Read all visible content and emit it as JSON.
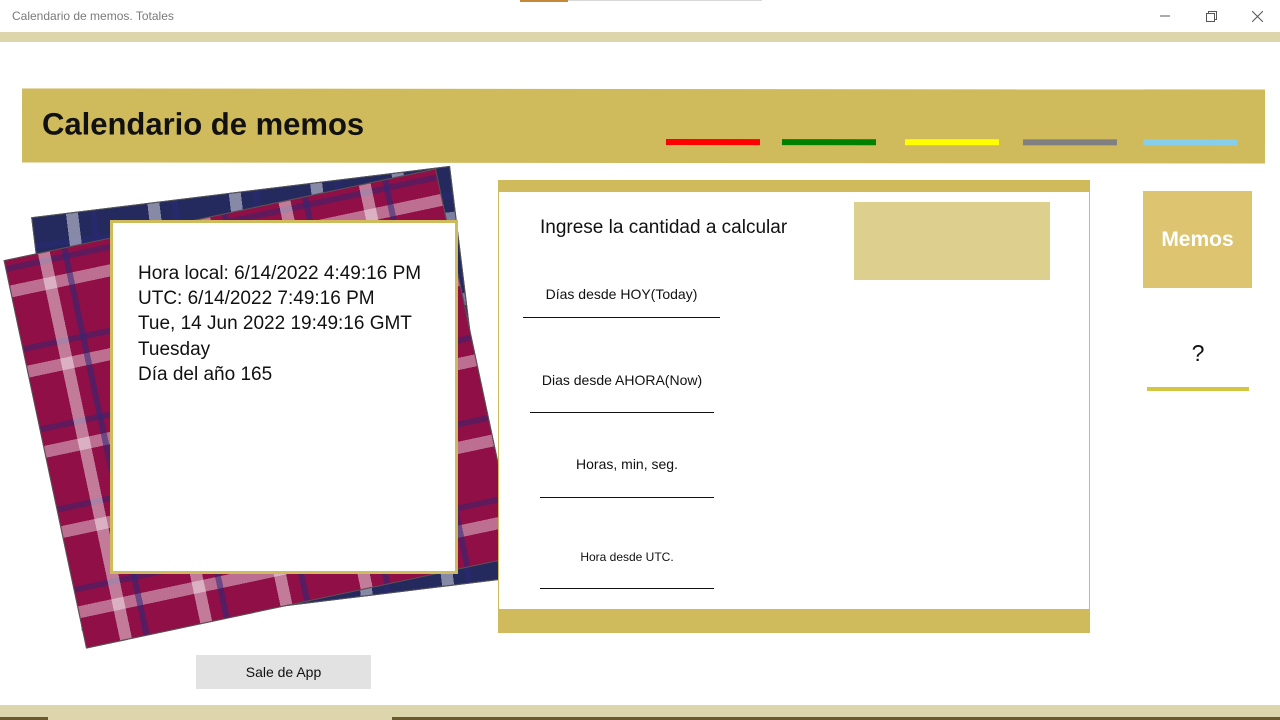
{
  "window": {
    "title": "Calendario de memos. Totales"
  },
  "header": {
    "title": "Calendario de memos",
    "color_bars": [
      "#ff0000",
      "#008000",
      "#ffff00",
      "#808080",
      "#87ceeb"
    ]
  },
  "info": {
    "local_time": "Hora local: 6/14/2022 4:49:16 PM",
    "utc_time": "UTC: 6/14/2022 7:49:16 PM",
    "gmt_string": "Tue, 14 Jun 2022 19:49:16 GMT",
    "weekday": "Tuesday",
    "day_of_year": "Día del año 165"
  },
  "exit_button": {
    "label": "Sale de App"
  },
  "calculator": {
    "prompt": "Ingrese la cantidad a calcular",
    "input_value": "",
    "fields": [
      "Días desde HOY(Today)",
      "Dias desde AHORA(Now)",
      "Horas, min, seg.",
      "Hora desde UTC."
    ]
  },
  "side": {
    "memos_label": "Memos",
    "help_label": "?"
  },
  "colors": {
    "accent": "#cfba5c",
    "stripe": "#ddd6ad",
    "input_fill": "#ddd08f",
    "memos_fill": "#dcc470"
  }
}
